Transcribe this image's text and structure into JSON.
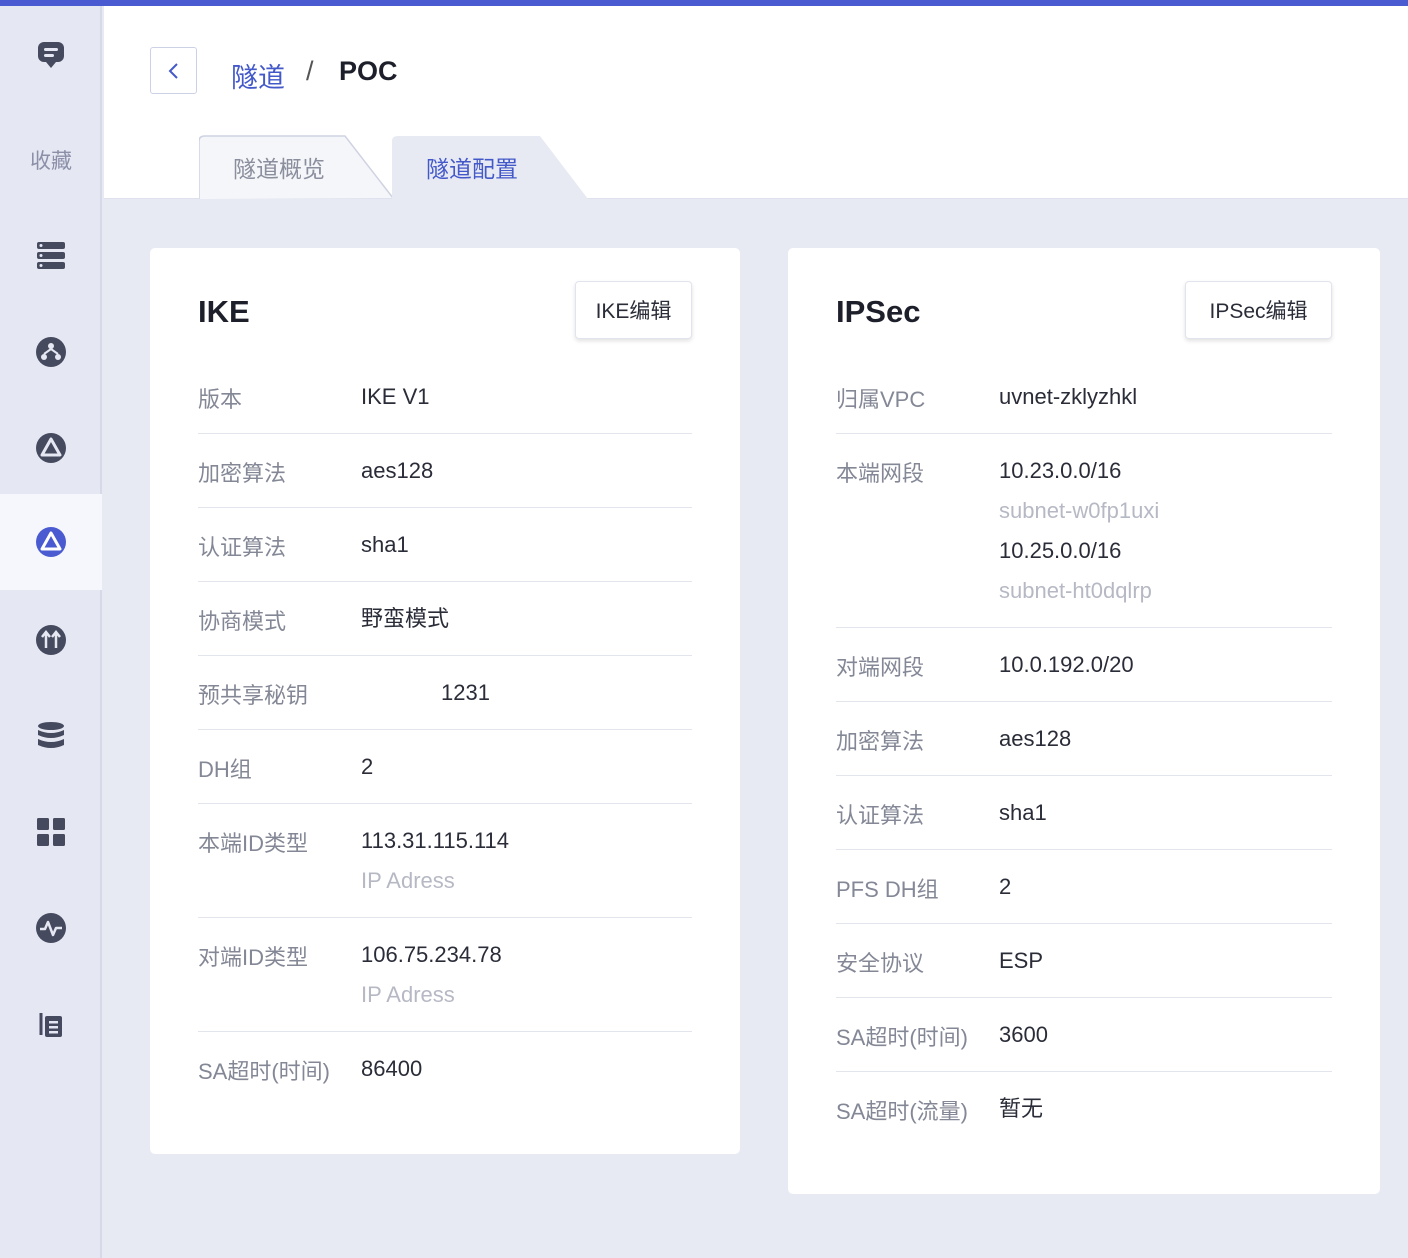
{
  "sidebar": {
    "favorites_label": "收藏",
    "items": [
      {
        "icon": "message-icon"
      },
      {
        "icon": "server-list-icon"
      },
      {
        "icon": "network-icon"
      },
      {
        "icon": "gateway-icon"
      },
      {
        "icon": "tunnel-icon",
        "active": true
      },
      {
        "icon": "transfer-icon"
      },
      {
        "icon": "database-icon"
      },
      {
        "icon": "apps-grid-icon"
      },
      {
        "icon": "monitor-icon"
      },
      {
        "icon": "documents-icon"
      }
    ],
    "accent_color": "#4a5bd1"
  },
  "breadcrumb": {
    "parent": "隧道",
    "separator": "/",
    "current": "POC"
  },
  "tabs": [
    {
      "label": "隧道概览",
      "active": false
    },
    {
      "label": "隧道配置",
      "active": true
    }
  ],
  "ike": {
    "title": "IKE",
    "edit_label": "IKE编辑",
    "rows": [
      {
        "label": "版本",
        "value": "IKE V1"
      },
      {
        "label": "加密算法",
        "value": "aes128"
      },
      {
        "label": "认证算法",
        "value": "sha1"
      },
      {
        "label": "协商模式",
        "value": "野蛮模式"
      },
      {
        "label": "预共享秘钥",
        "value": "1231"
      },
      {
        "label": "DH组",
        "value": "2"
      },
      {
        "label": "本端ID类型",
        "value": "113.31.115.114",
        "sub": "IP Adress"
      },
      {
        "label": "对端ID类型",
        "value": "106.75.234.78",
        "sub": "IP Adress"
      },
      {
        "label": "SA超时(时间)",
        "value": "86400"
      }
    ]
  },
  "ipsec": {
    "title": "IPSec",
    "edit_label": "IPSec编辑",
    "rows": [
      {
        "label": "归属VPC",
        "value": "uvnet-zklyzhkl"
      },
      {
        "label": "本端网段",
        "values": [
          {
            "value": "10.23.0.0/16",
            "sub": "subnet-w0fp1uxi"
          },
          {
            "value": "10.25.0.0/16",
            "sub": "subnet-ht0dqlrp"
          }
        ]
      },
      {
        "label": "对端网段",
        "value": "10.0.192.0/20"
      },
      {
        "label": "加密算法",
        "value": "aes128"
      },
      {
        "label": "认证算法",
        "value": "sha1"
      },
      {
        "label": "PFS DH组",
        "value": "2"
      },
      {
        "label": "安全协议",
        "value": "ESP"
      },
      {
        "label": "SA超时(时间)",
        "value": "3600"
      },
      {
        "label": "SA超时(流量)",
        "value": "暂无"
      }
    ]
  }
}
